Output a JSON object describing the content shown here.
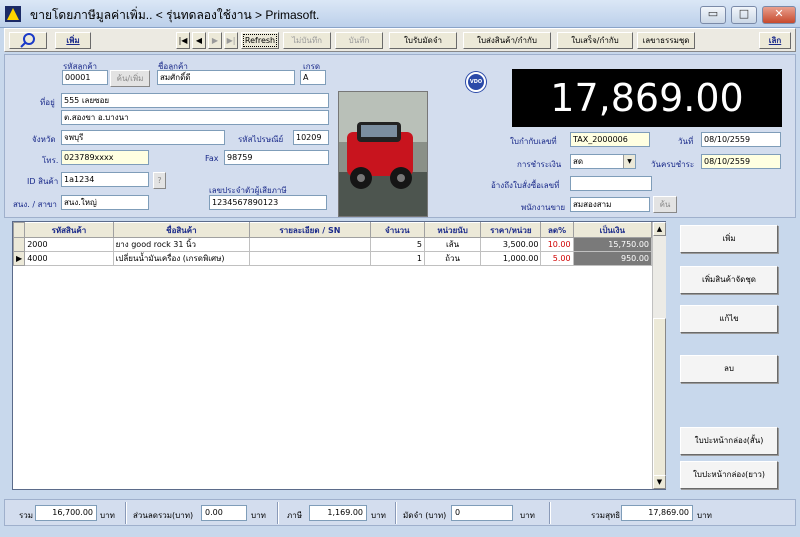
{
  "window": {
    "title": "ขายโดยภาษีมูลค่าเพิ่ม.. < รุ่นทดลองใช้งาน > Primasoft.",
    "min_label": "▭",
    "max_label": "□",
    "close_label": "✕"
  },
  "toolbar": {
    "add_label": "เพิ่ม",
    "first_label": "|◀",
    "prev_label": "◀",
    "next_label": "▶",
    "last_label": "▶|",
    "refresh_label": "Refresh",
    "unsave_label": "ไม่บันทึก",
    "save_label": "บันทึก",
    "deposit_label": "ใบรับมัดจำ",
    "delivery_label": "ใบส่งสินค้า/กำกับ",
    "receipt_label": "ใบเสร็จ/กำกับ",
    "set_no_label": "เลขาธรรมชุด",
    "exit_label": "เลิก"
  },
  "customer": {
    "code_label": "รหัสลูกค้า",
    "code": "00001",
    "search_label": "ค้น/เพิ่ม",
    "name_label": "ชื่อลูกค้า",
    "name": "สมศักดิ์ดี",
    "grade_label": "เกรด",
    "grade": "A",
    "address_label": "ที่อยู่",
    "address1": "555 เลยซอย",
    "address2": "ต.สองขา อ.บางนา",
    "province_label": "จังหวัด",
    "province": "จพบุรี",
    "postcode_label": "รหัสไปรษณีย์",
    "postcode": "10209",
    "phone_label": "โทร.",
    "phone": "023789xxxx",
    "fax_label": "Fax",
    "fax": "98759",
    "product_id_label": "ID สินค้า",
    "product_id": "1a1234",
    "product_q_label": "?",
    "branch_label": "สนง. / สาขา",
    "branch": "สนง.ใหญ่",
    "tax_id_label": "เลขประจำตัวผู้เสียภาษี",
    "tax_id": "1234567890123"
  },
  "logo_text": "VDO",
  "total_display": "17,869.00",
  "invoice": {
    "tax_no_label": "ใบกำกับเลขที่",
    "tax_no": "TAX_2000006",
    "date_label": "วันที่",
    "date": "08/10/2559",
    "payment_label": "การชำระเงิน",
    "payment": "สด",
    "due_label": "วันครบชำระ",
    "due": "08/10/2559",
    "ref_label": "อ้างถึงใบสั่งซื้อเลขที่",
    "ref": "",
    "salesman_label": "พนักงานขาย",
    "salesman": "สมสองสาม",
    "salesman_search": "ค้น"
  },
  "grid": {
    "columns": [
      "รหัสสินค้า",
      "ชื่อสินค้า",
      "รายละเอียด / SN",
      "จำนวน",
      "หน่วยนับ",
      "ราคา/หน่วย",
      "ลด%",
      "เป็นเงิน"
    ],
    "rows": [
      {
        "code": "2000",
        "name": "ยาง good rock 31 นิ้ว",
        "detail": "",
        "qty": "5",
        "unit": "เส้น",
        "price": "3,500.00",
        "disc": "10.00",
        "amount": "15,750.00"
      },
      {
        "code": "4000",
        "name": "เปลี่ยนน้ำมันเครื่อง (เกรดพิเศษ)",
        "detail": "",
        "qty": "1",
        "unit": "ถ้วน",
        "price": "1,000.00",
        "disc": "5.00",
        "amount": "950.00"
      }
    ],
    "current_row_marker": "▶",
    "scroll_up": "▲",
    "scroll_down": "▼"
  },
  "actions": {
    "add": "เพิ่ม",
    "add_set": "เพิ่มสินค้าจัดชุด",
    "edit": "แก้ไข",
    "delete": "ลบ",
    "print_short": "ใบปะหน้ากล่อง(สั้น)",
    "print_long": "ใบปะหน้ากล่อง(ยาว)"
  },
  "summary": {
    "total_label": "รวม",
    "total": "16,700.00",
    "baht1": "บาท",
    "discount_label": "ส่วนลดรวม(บาท)",
    "discount": "0.00",
    "baht2": "บาท",
    "vat_label": "ภาษี",
    "vat": "1,169.00",
    "baht3": "บาท",
    "deposit_label": "มัดจำ (บาท)",
    "deposit": "0",
    "baht4": "บาท",
    "net_label": "รวมสุทธิ",
    "net": "17,869.00",
    "baht5": "บาท"
  },
  "colors": {
    "accent": "#1a2a8a",
    "display_bg": "#000000",
    "display_fg": "#ffffff",
    "discount": "#d00000"
  }
}
